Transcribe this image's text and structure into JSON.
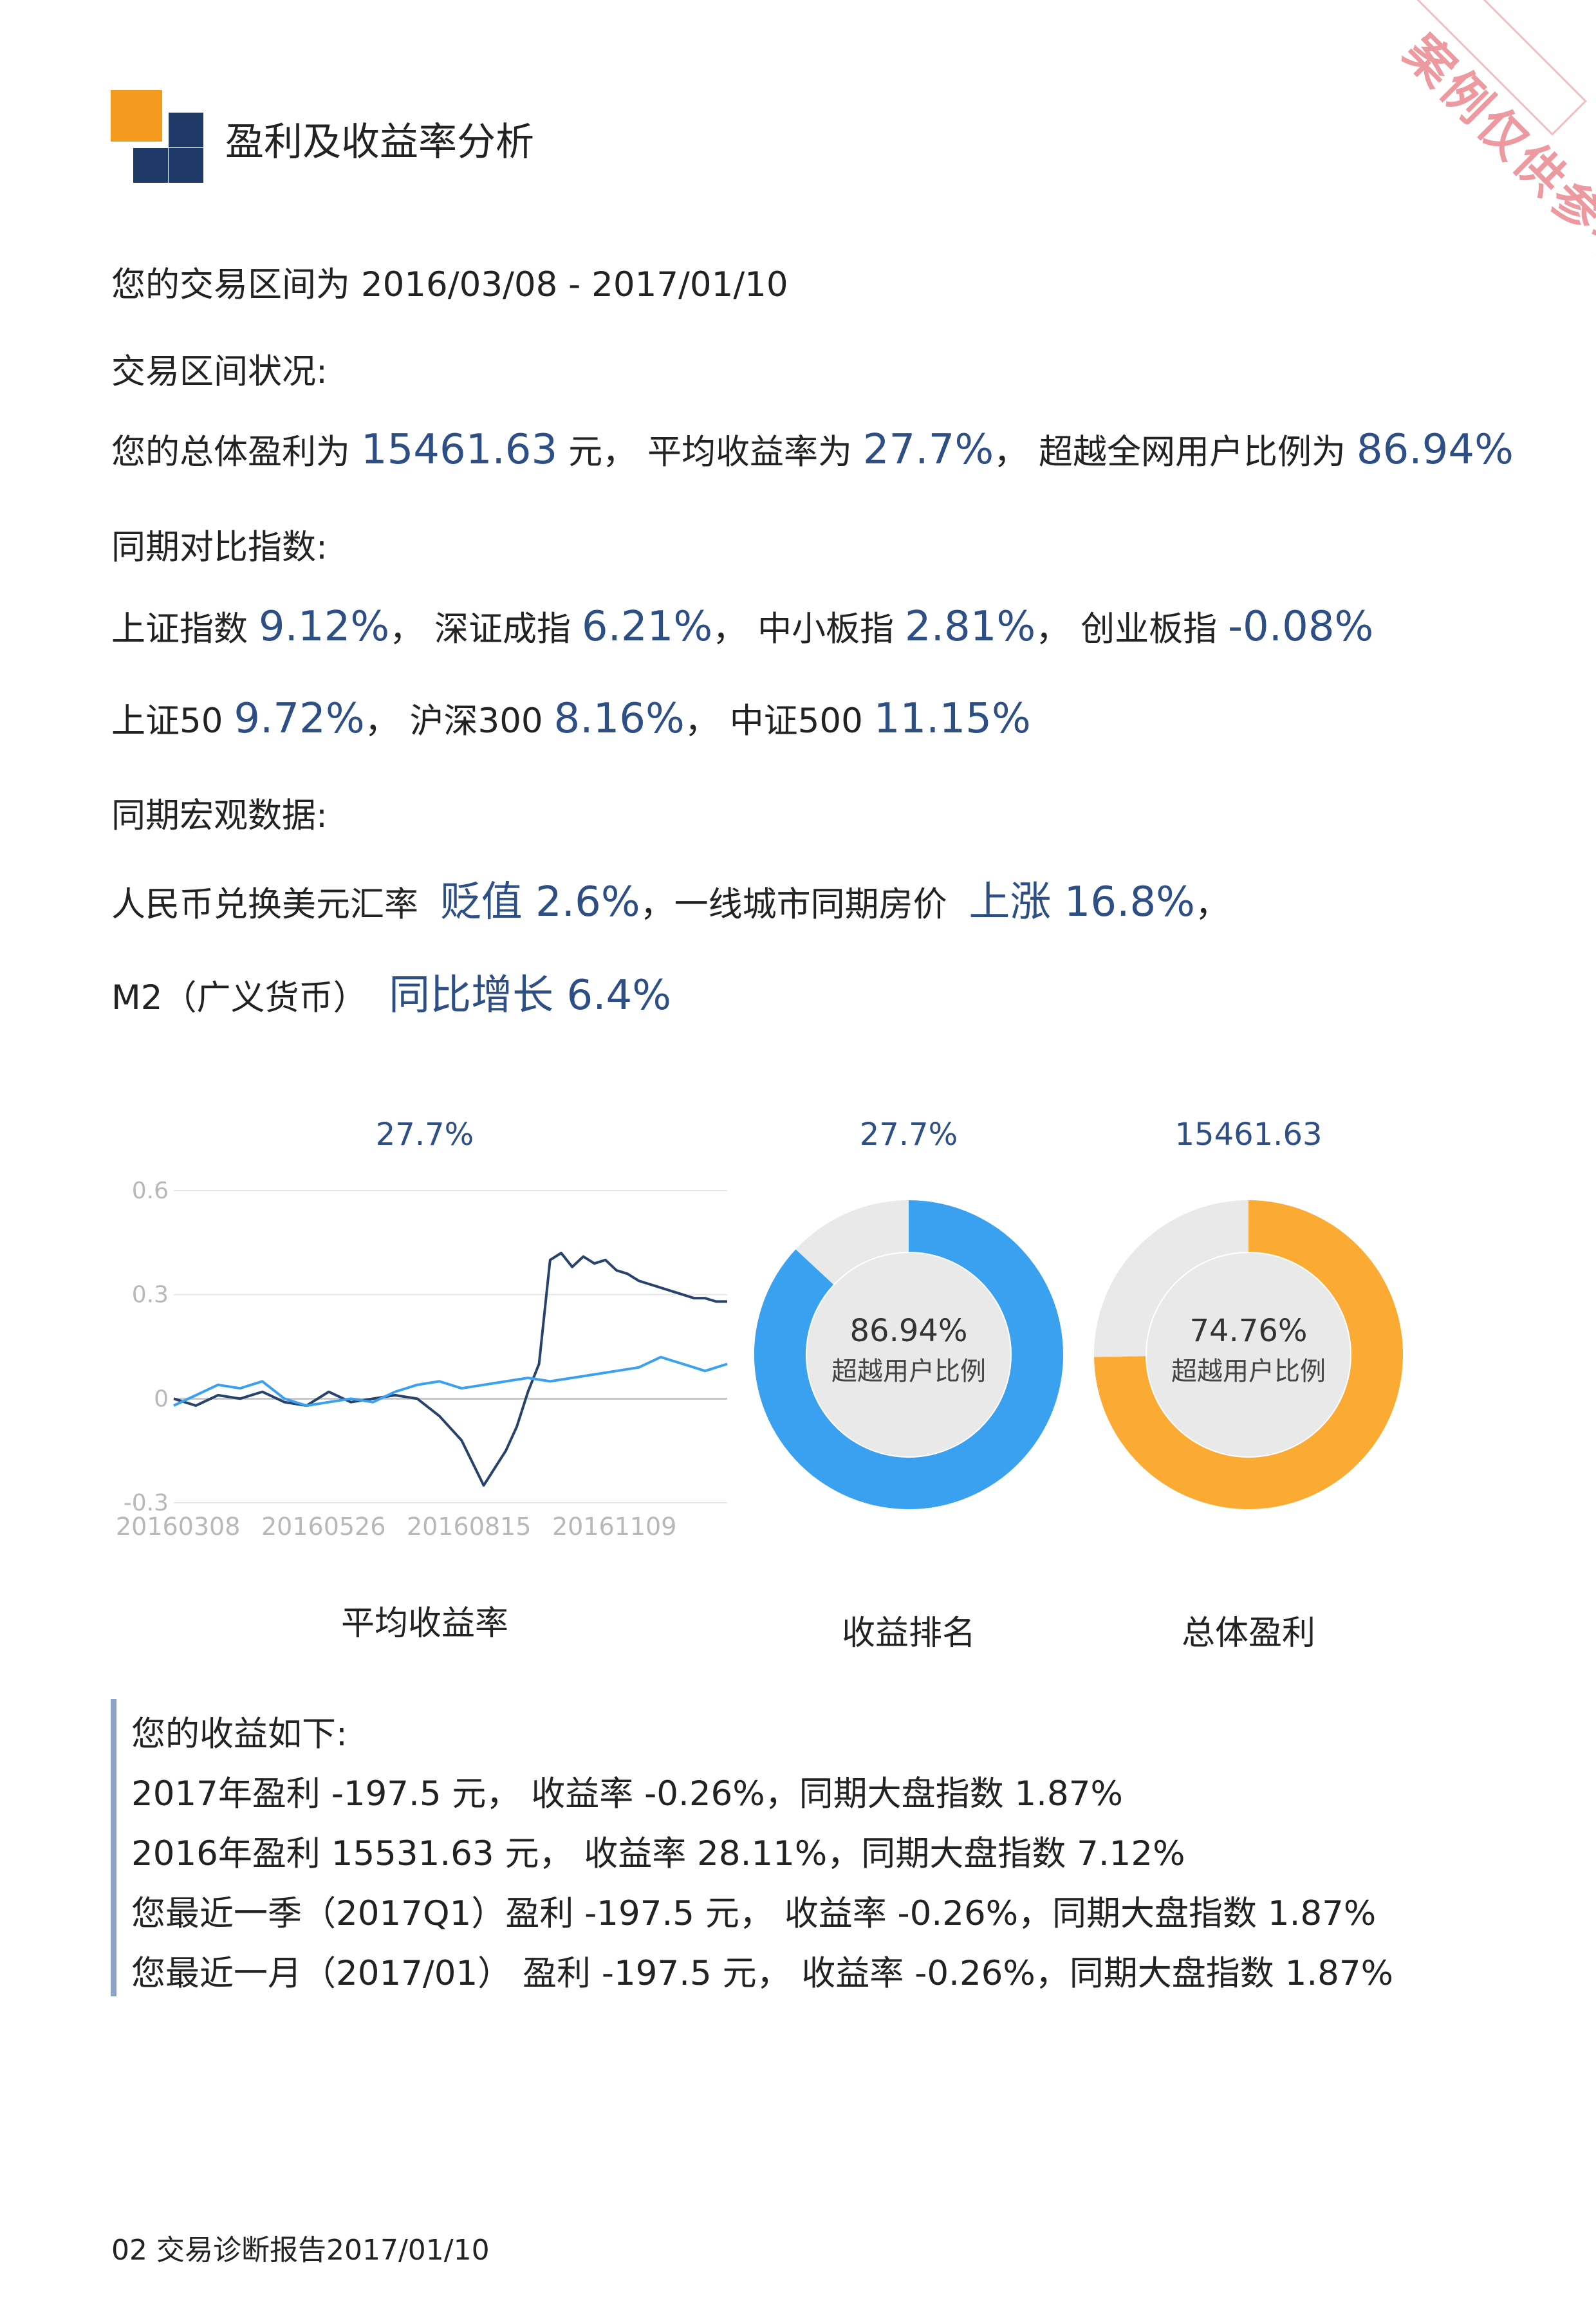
{
  "header": {
    "title": "盈利及收益率分析"
  },
  "stamp": {
    "text": "案例仅供参考"
  },
  "period": {
    "label": "您的交易区间为",
    "range": "2016/03/08 - 2017/01/10"
  },
  "status": {
    "heading": "交易区间状况:",
    "profit_label": "您的总体盈利为",
    "profit": "15461.63",
    "unit": "元，",
    "avg_label": "平均收益率为",
    "avg": "27.7%",
    "sep": "，",
    "beat_label": "超越全网用户比例为",
    "beat": "86.94%"
  },
  "indices": {
    "heading": "同期对比指数:",
    "row1": [
      {
        "name": "上证指数",
        "value": "9.12%",
        "sep": "，"
      },
      {
        "name": "深证成指",
        "value": "6.21%",
        "sep": "，"
      },
      {
        "name": "中小板指",
        "value": "2.81%",
        "sep": "，"
      },
      {
        "name": "创业板指",
        "value": "-0.08%",
        "sep": ""
      }
    ],
    "row2": [
      {
        "name": "上证50",
        "value": "9.72%",
        "sep": "，"
      },
      {
        "name": "沪深300",
        "value": "8.16%",
        "sep": "，"
      },
      {
        "name": "中证500",
        "value": "11.15%",
        "sep": ""
      }
    ]
  },
  "macro": {
    "heading": "同期宏观数据:",
    "fx_label": "人民币兑换美元汇率",
    "fx_value": "贬值 2.6%",
    "house_label": "，一线城市同期房价",
    "house_value": "上涨 16.8%",
    "house_sep": "，",
    "m2_label": "M2（广义货币）",
    "m2_value": "同比增长 6.4%"
  },
  "charts": {
    "line_top": "27.7%",
    "rank_top": "27.7%",
    "profit_top": "15461.63",
    "line_caption": "平均收益率",
    "rank_caption": "收益排名",
    "profit_caption": "总体盈利",
    "rank_center_value": "86.94%",
    "rank_center_label": "超越用户比例",
    "profit_center_value": "74.76%",
    "profit_center_label": "超越用户比例",
    "colors": {
      "blue": "#3aa0f0",
      "orange": "#fbab33",
      "track": "#e9e9e9",
      "navy": "#27426b",
      "accent": "#2d4f86"
    }
  },
  "chart_data": [
    {
      "type": "line",
      "title": "",
      "x_ticks": [
        "20160308",
        "20160526",
        "20160815",
        "20161109"
      ],
      "y_ticks": [
        0.6,
        0.3,
        0,
        -0.3
      ],
      "ylim": [
        -0.3,
        0.6
      ],
      "grid": true,
      "series": [
        {
          "color": "#27426b",
          "x": [
            0,
            4,
            8,
            12,
            16,
            20,
            24,
            28,
            32,
            36,
            40,
            44,
            48,
            52,
            56,
            60,
            62,
            64,
            66,
            68,
            70,
            72,
            74,
            76,
            78,
            80,
            82,
            84,
            86,
            88,
            90,
            92,
            94,
            96,
            98,
            100
          ],
          "y": [
            0.0,
            -0.02,
            0.01,
            0.0,
            0.02,
            -0.01,
            -0.02,
            0.02,
            -0.01,
            0.0,
            0.01,
            0.0,
            -0.05,
            -0.12,
            -0.25,
            -0.15,
            -0.08,
            0.02,
            0.1,
            0.4,
            0.42,
            0.38,
            0.41,
            0.39,
            0.4,
            0.37,
            0.36,
            0.34,
            0.33,
            0.32,
            0.31,
            0.3,
            0.29,
            0.29,
            0.28,
            0.28
          ]
        },
        {
          "color": "#3aa0f0",
          "x": [
            0,
            4,
            8,
            12,
            16,
            20,
            24,
            28,
            32,
            36,
            40,
            44,
            48,
            52,
            56,
            60,
            64,
            68,
            72,
            76,
            80,
            84,
            88,
            90,
            92,
            94,
            96,
            98,
            100
          ],
          "y": [
            -0.02,
            0.01,
            0.04,
            0.03,
            0.05,
            0.0,
            -0.02,
            -0.01,
            0.0,
            -0.01,
            0.02,
            0.04,
            0.05,
            0.03,
            0.04,
            0.05,
            0.06,
            0.05,
            0.06,
            0.07,
            0.08,
            0.09,
            0.12,
            0.11,
            0.1,
            0.09,
            0.08,
            0.09,
            0.1
          ]
        }
      ]
    },
    {
      "type": "pie",
      "title": "收益排名",
      "values": [
        86.94,
        13.06
      ],
      "center_value": "86.94%"
    },
    {
      "type": "pie",
      "title": "总体盈利",
      "values": [
        74.76,
        25.24
      ],
      "center_value": "74.76%"
    }
  ],
  "summary": {
    "heading": "您的收益如下:",
    "lines": [
      "2017年盈利 -197.5 元， 收益率 -0.26%，同期大盘指数 1.87%",
      "2016年盈利 15531.63 元， 收益率 28.11%，同期大盘指数 7.12%",
      "您最近一季（2017Q1）盈利 -197.5 元， 收益率 -0.26%，同期大盘指数 1.87%",
      "您最近一月（2017/01） 盈利 -197.5 元， 收益率 -0.26%，同期大盘指数 1.87%"
    ]
  },
  "footer": {
    "text": "02 交易诊断报告2017/01/10"
  }
}
